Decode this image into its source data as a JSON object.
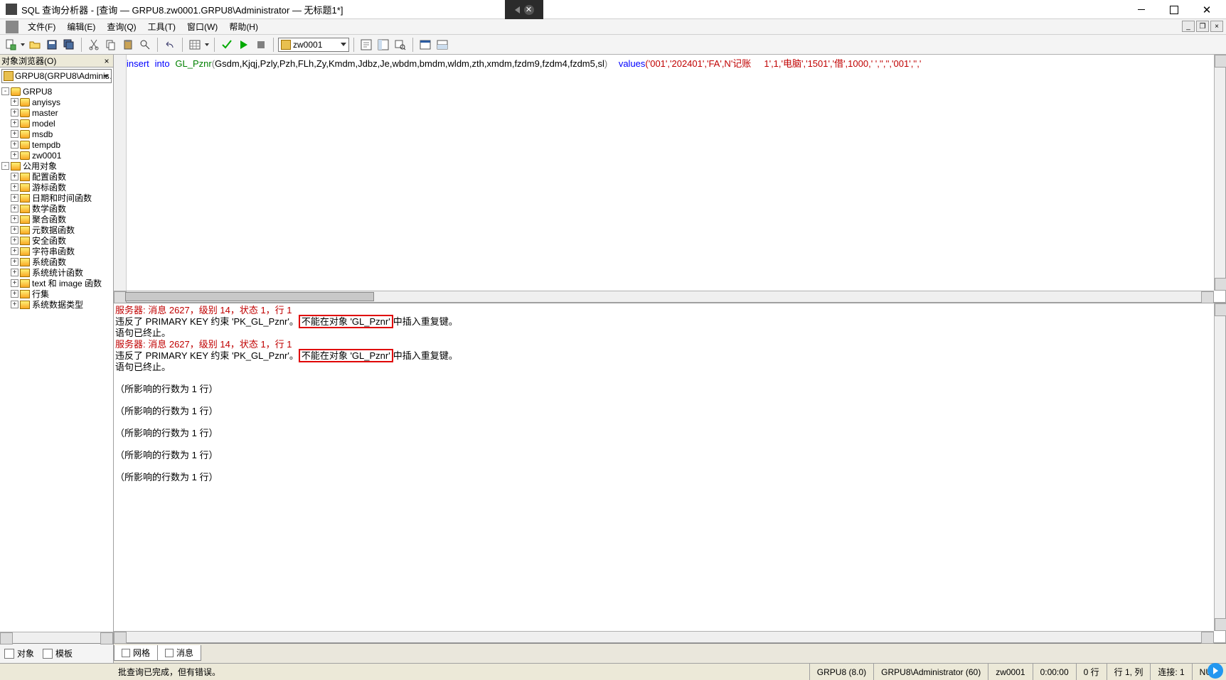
{
  "titlebar": {
    "text": "SQL 查询分析器 - [查询 — GRPU8.zw0001.GRPU8\\Administrator — 无标题1*]"
  },
  "menu": {
    "file": "文件(F)",
    "edit": "编辑(E)",
    "query": "查询(Q)",
    "tools": "工具(T)",
    "window": "窗口(W)",
    "help": "帮助(H)"
  },
  "toolbar": {
    "db_selected": "zw0001"
  },
  "object_browser": {
    "title": "对象浏览器(O)",
    "combo": "GRPU8(GRPU8\\Adminis…",
    "nodes": [
      {
        "label": "GRPU8",
        "kind": "db",
        "depth": 0,
        "expand": "-"
      },
      {
        "label": "anyisys",
        "kind": "db",
        "depth": 1,
        "expand": "+"
      },
      {
        "label": "master",
        "kind": "db",
        "depth": 1,
        "expand": "+"
      },
      {
        "label": "model",
        "kind": "db",
        "depth": 1,
        "expand": "+"
      },
      {
        "label": "msdb",
        "kind": "db",
        "depth": 1,
        "expand": "+"
      },
      {
        "label": "tempdb",
        "kind": "db",
        "depth": 1,
        "expand": "+"
      },
      {
        "label": "zw0001",
        "kind": "db",
        "depth": 1,
        "expand": "+"
      },
      {
        "label": "公用对象",
        "kind": "folder",
        "depth": 0,
        "expand": "-"
      },
      {
        "label": "配置函数",
        "kind": "folder",
        "depth": 1,
        "expand": "+"
      },
      {
        "label": "游标函数",
        "kind": "folder",
        "depth": 1,
        "expand": "+"
      },
      {
        "label": "日期和时间函数",
        "kind": "folder",
        "depth": 1,
        "expand": "+"
      },
      {
        "label": "数学函数",
        "kind": "folder",
        "depth": 1,
        "expand": "+"
      },
      {
        "label": "聚合函数",
        "kind": "folder",
        "depth": 1,
        "expand": "+"
      },
      {
        "label": "元数据函数",
        "kind": "folder",
        "depth": 1,
        "expand": "+"
      },
      {
        "label": "安全函数",
        "kind": "folder",
        "depth": 1,
        "expand": "+"
      },
      {
        "label": "字符串函数",
        "kind": "folder",
        "depth": 1,
        "expand": "+"
      },
      {
        "label": "系统函数",
        "kind": "folder",
        "depth": 1,
        "expand": "+"
      },
      {
        "label": "系统统计函数",
        "kind": "folder",
        "depth": 1,
        "expand": "+"
      },
      {
        "label": "text 和 image 函数",
        "kind": "folder",
        "depth": 1,
        "expand": "+"
      },
      {
        "label": "行集",
        "kind": "folder",
        "depth": 1,
        "expand": "+"
      },
      {
        "label": "系统数据类型",
        "kind": "folder",
        "depth": 1,
        "expand": "+"
      }
    ]
  },
  "editor": {
    "kw1": "insert",
    "kw2": "into",
    "table": "GL_Pznr",
    "cols_open": "(",
    "cols": "Gsdm,Kjqj,Pzly,Pzh,FLh,Zy,Kmdm,Jdbz,Je,wbdm,bmdm,wldm,zth,xmdm,fzdm9,fzdm4,fzdm5,sl",
    "cols_close": ")",
    "kw3": "values",
    "vals": "('001','202401','FA',N'记账     1',1,'电脑','1501','借',1000,' ','','','001','','"
  },
  "messages": {
    "err1_head": "服务器: 消息 2627，级别 14，状态 1，行 1",
    "err_line_a": "违反了 PRIMARY KEY 约束 'PK_GL_Pznr'。",
    "err_highlight": "不能在对象 'GL_Pznr'",
    "err_line_b": "中插入重复键。",
    "err_abort": "语句已终止。",
    "err2_head": "服务器: 消息 2627，级别 14，状态 1，行 1",
    "rows1": "（所影响的行数为 1 行）",
    "rows2": "（所影响的行数为 1 行）",
    "rows3": "（所影响的行数为 1 行）",
    "rows4": "（所影响的行数为 1 行）",
    "rows5": "（所影响的行数为 1 行）"
  },
  "mid_tabs": {
    "left_obj": "对象",
    "left_tmpl": "模板",
    "tab_grid": "网格",
    "tab_msg": "消息"
  },
  "status": {
    "left": "批查询已完成，但有错误。",
    "server": "GRPU8 (8.0)",
    "user": "GRPU8\\Administrator (60)",
    "db": "zw0001",
    "time": "0:00:00",
    "rows": "0 行",
    "pos": "行 1, 列",
    "conn": "连接: 1",
    "num": "NUM"
  }
}
